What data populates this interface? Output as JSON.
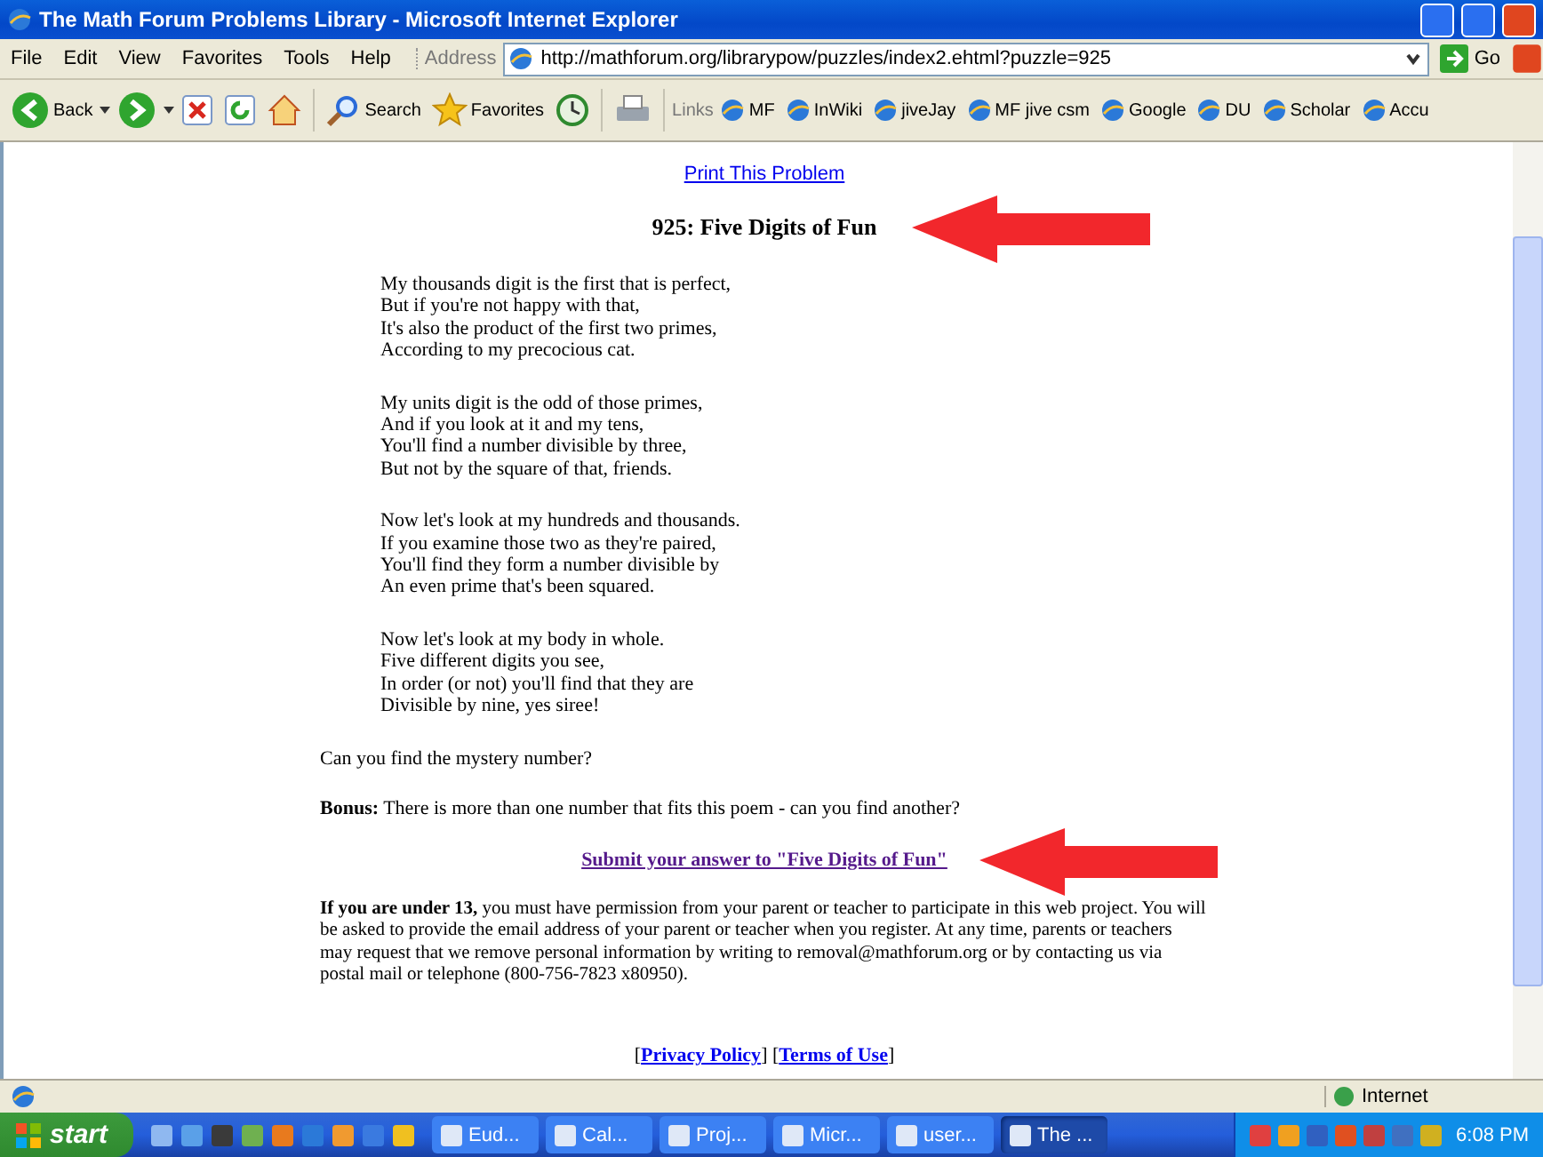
{
  "window": {
    "title": "The Math Forum Problems Library - Microsoft Internet Explorer"
  },
  "menu": [
    "File",
    "Edit",
    "View",
    "Favorites",
    "Tools",
    "Help"
  ],
  "address": {
    "label": "Address",
    "value": "http://mathforum.org/librarypow/puzzles/index2.ehtml?puzzle=925",
    "go": "Go"
  },
  "toolbar": [
    {
      "kind": "back",
      "label": "Back"
    },
    {
      "kind": "forward"
    },
    {
      "kind": "stop"
    },
    {
      "kind": "refresh"
    },
    {
      "kind": "home"
    },
    {
      "kind": "search",
      "label": "Search"
    },
    {
      "kind": "favorites",
      "label": "Favorites"
    },
    {
      "kind": "history"
    },
    {
      "kind": "print"
    }
  ],
  "links": {
    "label": "Links",
    "items": [
      "MF",
      "InWiki",
      "jiveJay",
      "MF jive csm",
      "Google",
      "DU",
      "Scholar",
      "Accu"
    ]
  },
  "page": {
    "print_link": "Print This Problem",
    "heading": "925: Five Digits of Fun",
    "stanzas": [
      [
        "My thousands digit is the first that is perfect,",
        "But if you're not happy with that,",
        "It's also the product of the first two primes,",
        "According to my precocious cat."
      ],
      [
        "My units digit is the odd of those primes,",
        "And if you look at it and my tens,",
        "You'll find a number divisible by three,",
        "But not by the square of that, friends."
      ],
      [
        "Now let's look at my hundreds and thousands.",
        "If you examine those two as they're paired,",
        "You'll find they form a number divisible by",
        "An even prime that's been squared."
      ],
      [
        "Now let's look at my body in whole.",
        "Five different digits you see,",
        "In order (or not) you'll find that they are",
        "Divisible by nine, yes siree!"
      ]
    ],
    "question": "Can you find the mystery number?",
    "bonus": "**Bonus:** There is more than one number that fits this poem - can you find another?",
    "submit_link": "Submit your answer to  \"Five Digits of Fun\"",
    "notice": "**If you are under 13,** you must have permission from your parent or teacher to participate in this web project. You will be asked to provide the email address of your parent or teacher when you register. At any time, parents or teachers may request that we remove personal information by writing to removal@mathforum.org or by contacting us via postal mail or telephone (800-756-7823 x80950).",
    "footer_links": [
      "Privacy Policy",
      "Terms of Use"
    ],
    "brackets": [
      "[",
      "] [",
      "]"
    ]
  },
  "status_bar": {
    "zone": "Internet"
  },
  "taskbar": {
    "start": "start",
    "tasks": [
      {
        "label": "Eud...",
        "selected": false
      },
      {
        "label": "Cal...",
        "selected": false
      },
      {
        "label": "Proj...",
        "selected": false
      },
      {
        "label": "Micr...",
        "selected": false
      },
      {
        "label": "user...",
        "selected": false
      },
      {
        "label": "The ...",
        "selected": true
      }
    ],
    "clock": "6:08 PM"
  }
}
